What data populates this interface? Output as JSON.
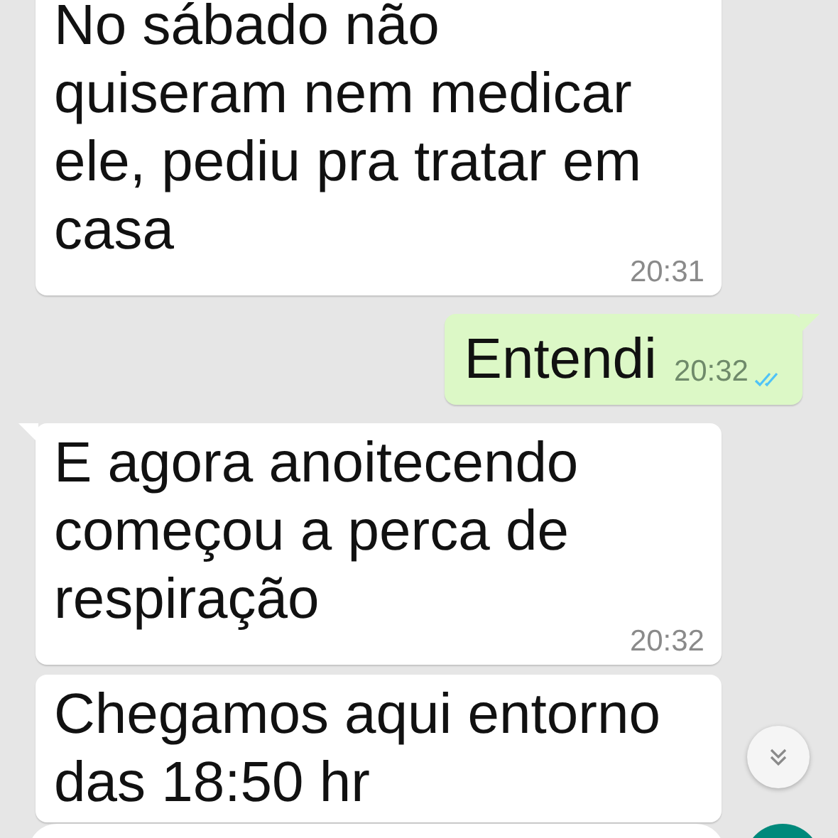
{
  "messages": [
    {
      "kind": "in",
      "tail": false,
      "text": "No sábado não quiseram nem medicar ele, pediu pra tratar em casa",
      "time": "20:31"
    },
    {
      "kind": "out",
      "tail": true,
      "text": "Entendi",
      "time": "20:32",
      "read": true
    },
    {
      "kind": "in",
      "tail": true,
      "text": "E agora anoitecendo começou a perca de respiração",
      "time": "20:32"
    },
    {
      "kind": "in",
      "tail": false,
      "text": "Chegamos aqui entorno das 18:50 hr"
    }
  ]
}
